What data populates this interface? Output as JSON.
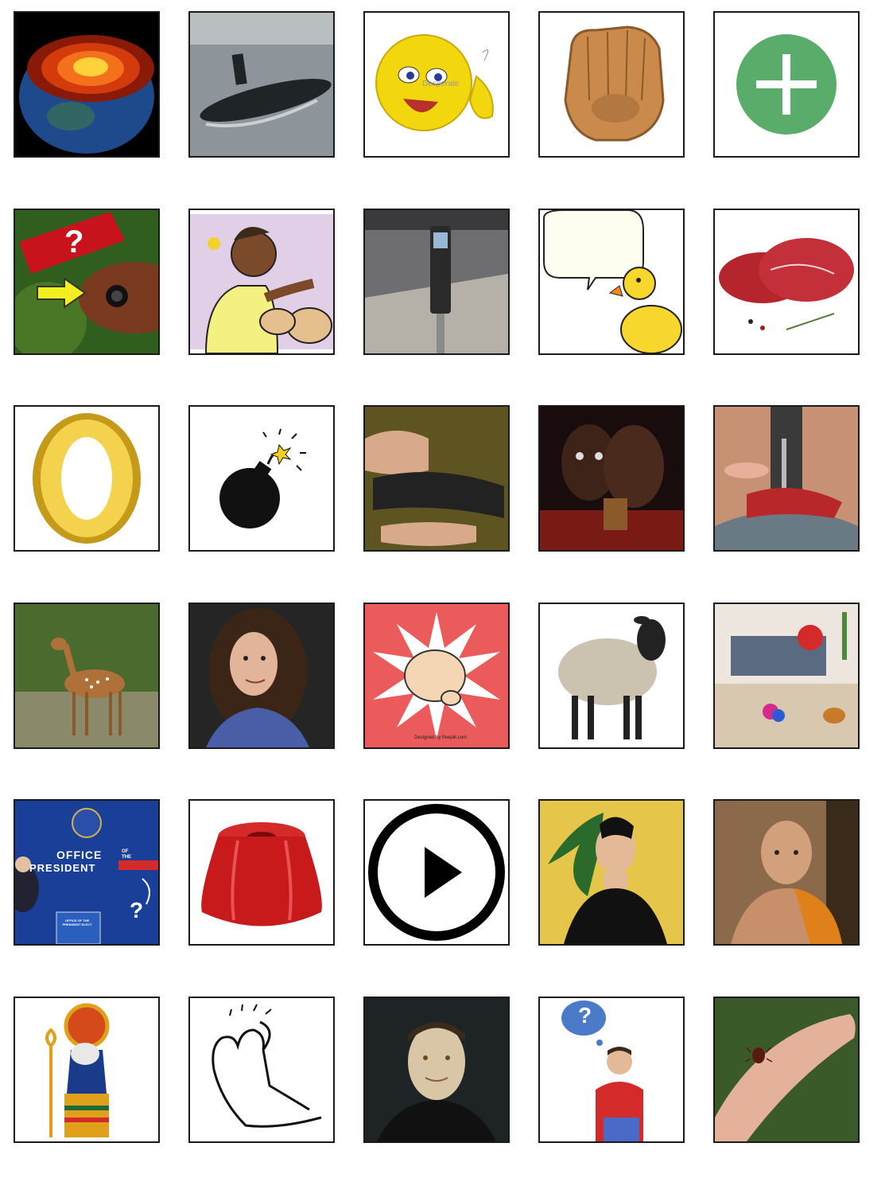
{
  "board": {
    "rows": 6,
    "columns": 5,
    "tiles": [
      {
        "id": "t-1-1",
        "icon": "earth-core-icon"
      },
      {
        "id": "t-1-2",
        "icon": "submarine-icon"
      },
      {
        "id": "t-1-3",
        "icon": "desperate-emoji-icon",
        "text": "Desperate"
      },
      {
        "id": "t-1-4",
        "icon": "baseball-glove-icon"
      },
      {
        "id": "t-1-5",
        "icon": "plus-icon",
        "color": "#5aac6b"
      },
      {
        "id": "t-2-1",
        "icon": "fish-question-icon",
        "text": "?"
      },
      {
        "id": "t-2-2",
        "icon": "pet-dog-icon"
      },
      {
        "id": "t-2-3",
        "icon": "parking-meter-icon"
      },
      {
        "id": "t-2-4",
        "icon": "duck-speech-icon"
      },
      {
        "id": "t-2-5",
        "icon": "raw-meat-icon"
      },
      {
        "id": "t-3-1",
        "icon": "gold-letter-o-icon"
      },
      {
        "id": "t-3-2",
        "icon": "bomb-icon"
      },
      {
        "id": "t-3-3",
        "icon": "elastic-band-icon"
      },
      {
        "id": "t-3-4",
        "icon": "two-faces-icon"
      },
      {
        "id": "t-3-5",
        "icon": "sewing-machine-icon"
      },
      {
        "id": "t-4-1",
        "icon": "deer-icon"
      },
      {
        "id": "t-4-2",
        "icon": "curly-hair-man-icon"
      },
      {
        "id": "t-4-3",
        "icon": "pointing-hand-icon",
        "color": "#ec5b5b",
        "text": "Designed by freepik.com"
      },
      {
        "id": "t-4-4",
        "icon": "sheep-icon"
      },
      {
        "id": "t-4-5",
        "icon": "messy-room-icon"
      },
      {
        "id": "t-5-1",
        "icon": "president-elect-icon",
        "color": "#1a3f99",
        "lines": [
          "OFFICE",
          "PRESIDENT",
          "OF",
          "THE",
          "OFFICE OF THE PRESIDENT ELECT",
          "?"
        ]
      },
      {
        "id": "t-5-2",
        "icon": "jelly-icon"
      },
      {
        "id": "t-5-3",
        "icon": "play-button-icon"
      },
      {
        "id": "t-5-4",
        "icon": "green-hair-woman-icon"
      },
      {
        "id": "t-5-5",
        "icon": "monk-icon"
      },
      {
        "id": "t-6-1",
        "icon": "egyptian-god-ra-icon"
      },
      {
        "id": "t-6-2",
        "icon": "foot-toes-icon"
      },
      {
        "id": "t-6-3",
        "icon": "android-data-icon"
      },
      {
        "id": "t-6-4",
        "icon": "thinking-man-question-icon",
        "text": "?"
      },
      {
        "id": "t-6-5",
        "icon": "tick-on-finger-icon"
      }
    ]
  }
}
